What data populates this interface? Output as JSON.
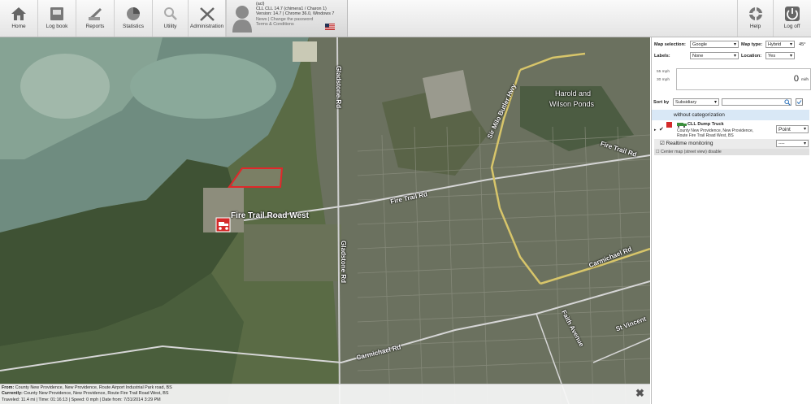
{
  "toolbar": {
    "home": "Home",
    "logbook": "Log book",
    "reports": "Reports",
    "statistics": "Statistics",
    "utility": "Utility",
    "administration": "Administration",
    "help": "Help",
    "logoff": "Log off"
  },
  "user": {
    "line1": "(acl)",
    "line2": "CLL CLL 14.7 (chimera1 / Charon 1)",
    "line3": "Version: 14.7  |  Chrome 36.0, Windows 7",
    "news": "News",
    "sep": "|",
    "change_password": "Change the password",
    "terms": "Terms & Conditions"
  },
  "map": {
    "place_label": "Fire Trail Road West",
    "road_labels": {
      "gladstone_top": "Gladstone Rd",
      "gladstone_bottom": "Gladstone Rd",
      "fire_trail_mid": "Fire Trail Rd",
      "fire_trail_right": "Fire Trail Rd",
      "sir_milo": "Sir Milo Butler Hwy",
      "harold1": "Harold and",
      "harold2": "Wilson Ponds",
      "carmichael_bottom": "Carmichael Rd",
      "carmichael_right": "Carmichael Rd",
      "faith": "Faith Avenue",
      "st_vincent": "St Vincent"
    }
  },
  "info": {
    "from_label": "From:",
    "from_value": "County New Providence, New Providence, Route Airport Industrial Park road, BS",
    "current_label": "Currently:",
    "current_value": "County New Providence, New Providence, Route Fire Trail Road West, BS",
    "stats": "Traveled: 11.4 mi | Time: 01:16:13 | Speed: 0 mph | Date from: 7/31/2014 3:29 PM"
  },
  "panel": {
    "map_selection_label": "Map selection:",
    "map_selection_value": "Google",
    "map_type_label": "Map type:",
    "map_type_value": "Hybrid",
    "angle": "45°",
    "labels_label": "Labels:",
    "labels_value": "None",
    "location_label": "Location:",
    "location_value": "Yes",
    "speed_55": "55 mph",
    "speed_30": "30 mph",
    "speed_value": "0",
    "speed_unit": "mi/h",
    "sort_label": "Sort by",
    "sort_value": "Subsidiary",
    "category": "without categorization",
    "vehicle_name": "CLL Dump Truck",
    "vehicle_addr1": "County New Providence, New Providence,",
    "vehicle_addr2": "Route Fire Trail Road West, BS",
    "vehicle_mode": "Point",
    "realtime": "Realtime monitoring",
    "realtime_value": "----",
    "center_map": "Center map (street view) disable"
  },
  "colors": {
    "route_area": "#e0282a",
    "highway": "#d7c56a",
    "category_bg": "#d9e8f6"
  }
}
